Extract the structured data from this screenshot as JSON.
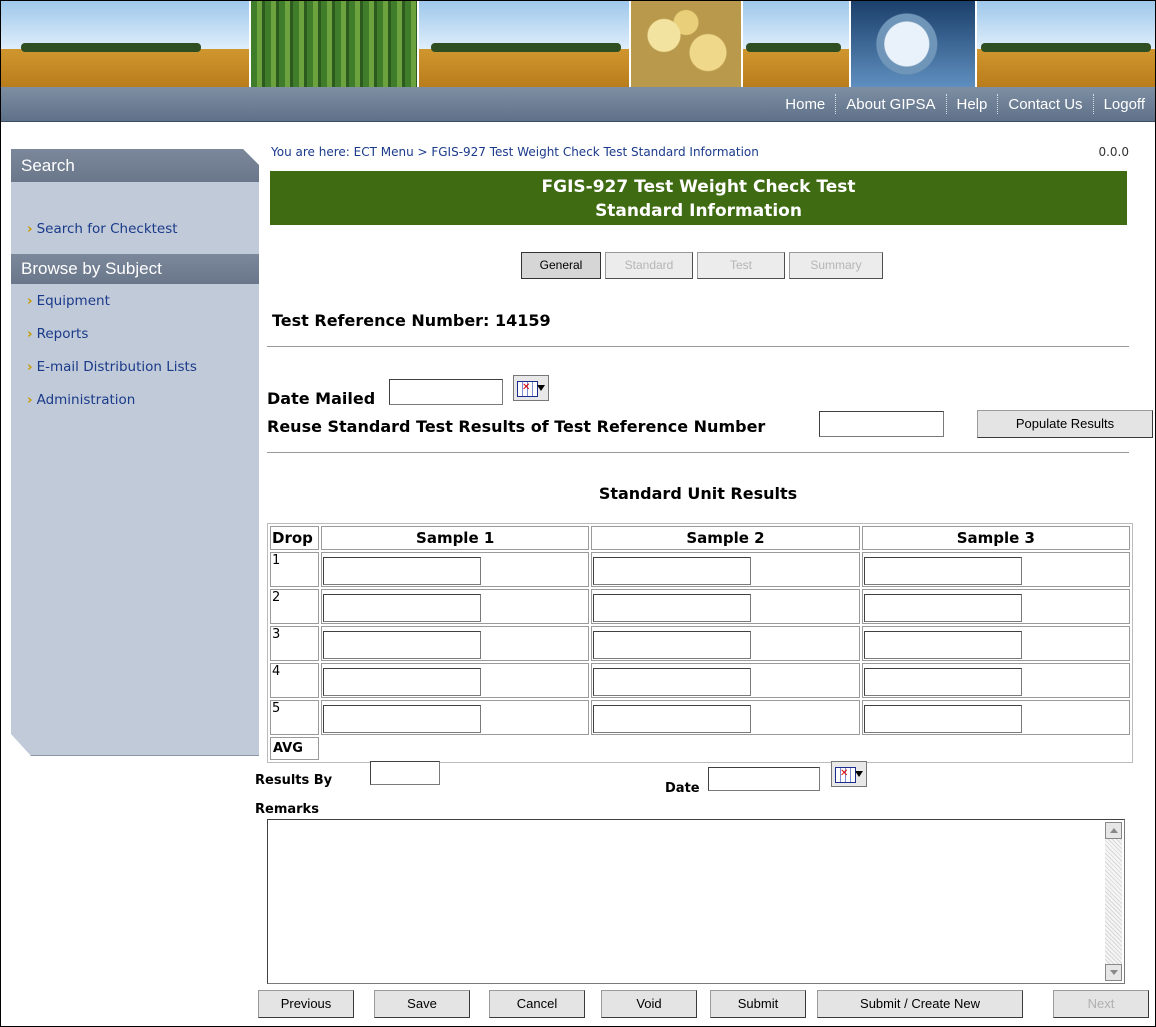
{
  "nav": {
    "home": "Home",
    "about": "About GIPSA",
    "help": "Help",
    "contact": "Contact Us",
    "logoff": "Logoff"
  },
  "sidebar": {
    "search_heading": "Search",
    "search_link": "Search for Checktest",
    "browse_heading": "Browse by Subject",
    "items": [
      {
        "label": "Equipment"
      },
      {
        "label": "Reports"
      },
      {
        "label": "E-mail Distribution Lists"
      },
      {
        "label": "Administration"
      }
    ]
  },
  "breadcrumb": "You are here: ECT Menu > FGIS-927 Test Weight Check Test Standard Information",
  "version": "0.0.0",
  "title": {
    "line1": "FGIS-927 Test Weight Check Test",
    "line2": "Standard Information"
  },
  "tabs": [
    {
      "label": "General",
      "active": true
    },
    {
      "label": "Standard",
      "active": false
    },
    {
      "label": "Test",
      "active": false
    },
    {
      "label": "Summary",
      "active": false
    }
  ],
  "test_reference": "Test Reference Number: 14159",
  "date_mailed": {
    "label": "Date Mailed",
    "value": ""
  },
  "reuse": {
    "label": "Reuse Standard Test Results of Test Reference Number",
    "value": "",
    "button": "Populate Results"
  },
  "results": {
    "title": "Standard Unit Results",
    "columns": [
      "Drop",
      "Sample 1",
      "Sample 2",
      "Sample 3"
    ],
    "rows": [
      "1",
      "2",
      "3",
      "4",
      "5"
    ],
    "avg_label": "AVG"
  },
  "results_by": {
    "label": "Results By",
    "value": ""
  },
  "date": {
    "label": "Date",
    "value": ""
  },
  "remarks": {
    "label": "Remarks",
    "value": ""
  },
  "buttons": {
    "previous": "Previous",
    "save": "Save",
    "cancel": "Cancel",
    "void": "Void",
    "submit": "Submit",
    "submit_create": "Submit / Create New",
    "next": "Next"
  },
  "colors": {
    "title_bar": "#3f6b12",
    "nav_bar": "#6f8196",
    "sidebar_bg": "#c1cad8",
    "link": "#1a3a8a"
  }
}
